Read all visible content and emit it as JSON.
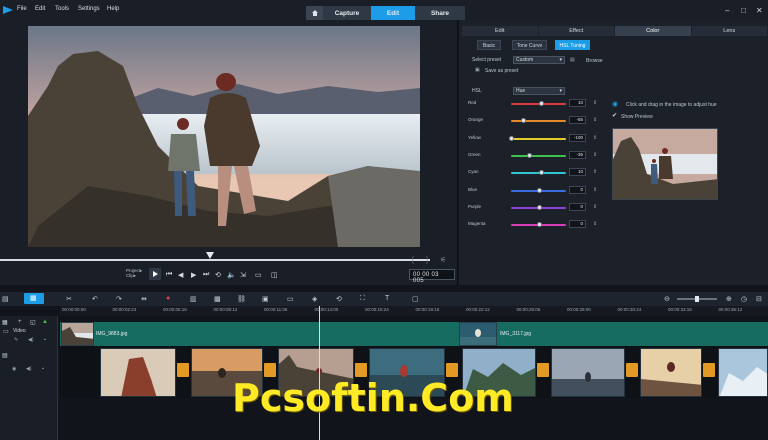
{
  "menu": {
    "file": "File",
    "edit": "Edit",
    "tools": "Tools",
    "settings": "Settings",
    "help": "Help"
  },
  "modes": {
    "capture": "Capture",
    "edit": "Edit",
    "share": "Share"
  },
  "player": {
    "project_label": "Project▸",
    "clip_label": "Clip▸",
    "timecode": "00 00 03 005"
  },
  "panel": {
    "tabs": [
      "Edit",
      "Effect",
      "Color",
      "Lens"
    ],
    "subtabs": {
      "basic": "Basic",
      "tone_curve": "Tone Curve",
      "hsl": "HSL Tuning"
    },
    "select_preset": "Select preset",
    "preset_value": "Custom",
    "browse": "Browse",
    "save_preset": "Save as preset",
    "hsl_label": "HSL",
    "hsl_value": "Hue",
    "sliders": [
      {
        "name": "Red",
        "value": "10",
        "pct": 0.55,
        "color": "#d93b3b"
      },
      {
        "name": "Orange",
        "value": "-55",
        "pct": 0.22,
        "color": "#e48a2b"
      },
      {
        "name": "Yellow",
        "value": "-100",
        "pct": 0.0,
        "color": "#e3cd2a"
      },
      {
        "name": "Green",
        "value": "-36",
        "pct": 0.32,
        "color": "#3fbf4b"
      },
      {
        "name": "Cyan",
        "value": "10",
        "pct": 0.55,
        "color": "#33c6d2"
      },
      {
        "name": "Blue",
        "value": "0",
        "pct": 0.5,
        "color": "#3a6ee0"
      },
      {
        "name": "Purple",
        "value": "0",
        "pct": 0.5,
        "color": "#8b43d6"
      },
      {
        "name": "Magenta",
        "value": "0",
        "pct": 0.5,
        "color": "#d63fb5"
      }
    ],
    "hint": "Click and drag in the image to adjust hue",
    "show_preview": "Show Preview"
  },
  "timeline": {
    "ruler": [
      "00:00:00:00",
      "00:00:02:24",
      "00:00:05:18",
      "00:00:08:12",
      "00:00:11:06",
      "00:00:14:00",
      "00:00:16:24",
      "00:00:19:18",
      "00:00:22:12",
      "00:00:25:06",
      "00:00:28:00",
      "00:00:30:24",
      "00:00:33:18",
      "00:00:36:12"
    ],
    "track_name": "Video",
    "clip1": "IMG_9883.jpg",
    "clip2": "IMG_3117.jpg"
  },
  "watermark": "Pcsoftin.Com",
  "colors": {
    "accent": "#1d9ce7",
    "track": "#176c61",
    "transition": "#e39a25"
  }
}
